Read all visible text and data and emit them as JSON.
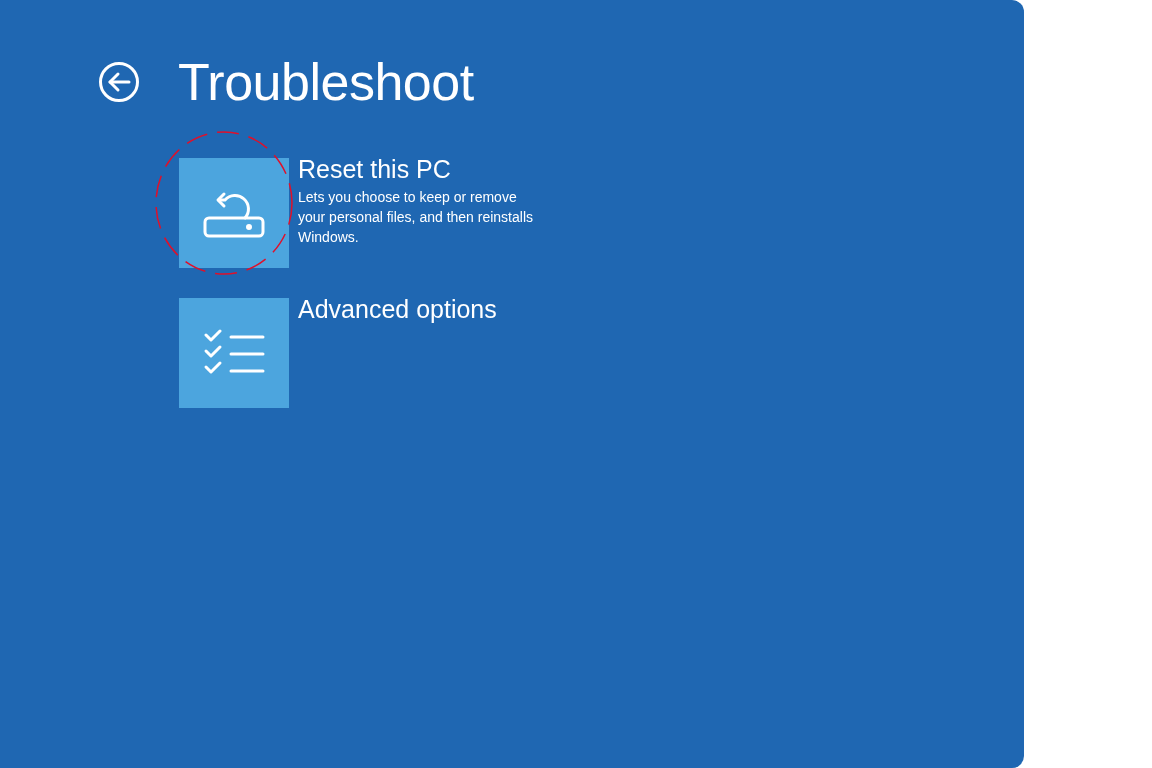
{
  "title": "Troubleshoot",
  "options": [
    {
      "kind": "reset",
      "title": "Reset this PC",
      "description": "Lets you choose to keep or remove your personal files, and then reinstalls Windows.",
      "highlighted": true
    },
    {
      "kind": "advanced",
      "title": "Advanced options",
      "highlighted": false
    }
  ]
}
